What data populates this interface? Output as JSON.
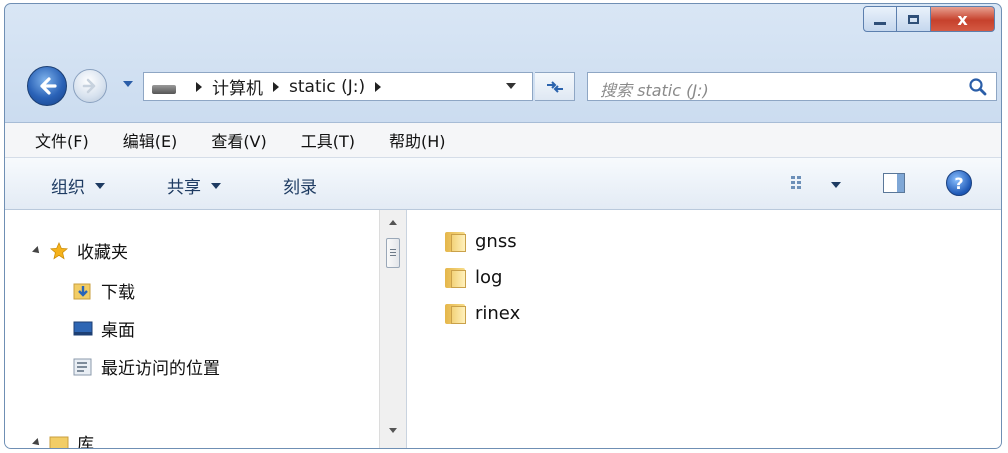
{
  "window": {
    "controls": {
      "minimize": "minimize",
      "maximize": "maximize",
      "close": "x"
    }
  },
  "nav": {
    "breadcrumb": [
      "计算机",
      "static (J:)"
    ],
    "search_placeholder": "搜索 static (J:)"
  },
  "menu": [
    "文件(F)",
    "编辑(E)",
    "查看(V)",
    "工具(T)",
    "帮助(H)"
  ],
  "commands": {
    "organize": "组织",
    "share": "共享",
    "burn": "刻录"
  },
  "navpane": {
    "favorites_label": "收藏夹",
    "items": [
      "下载",
      "桌面",
      "最近访问的位置"
    ],
    "library_label": "库"
  },
  "files": [
    "gnss",
    "log",
    "rinex"
  ],
  "colors": {
    "accent": "#2a62b7",
    "close_button": "#c6412c",
    "folder": "#f0c85a"
  }
}
